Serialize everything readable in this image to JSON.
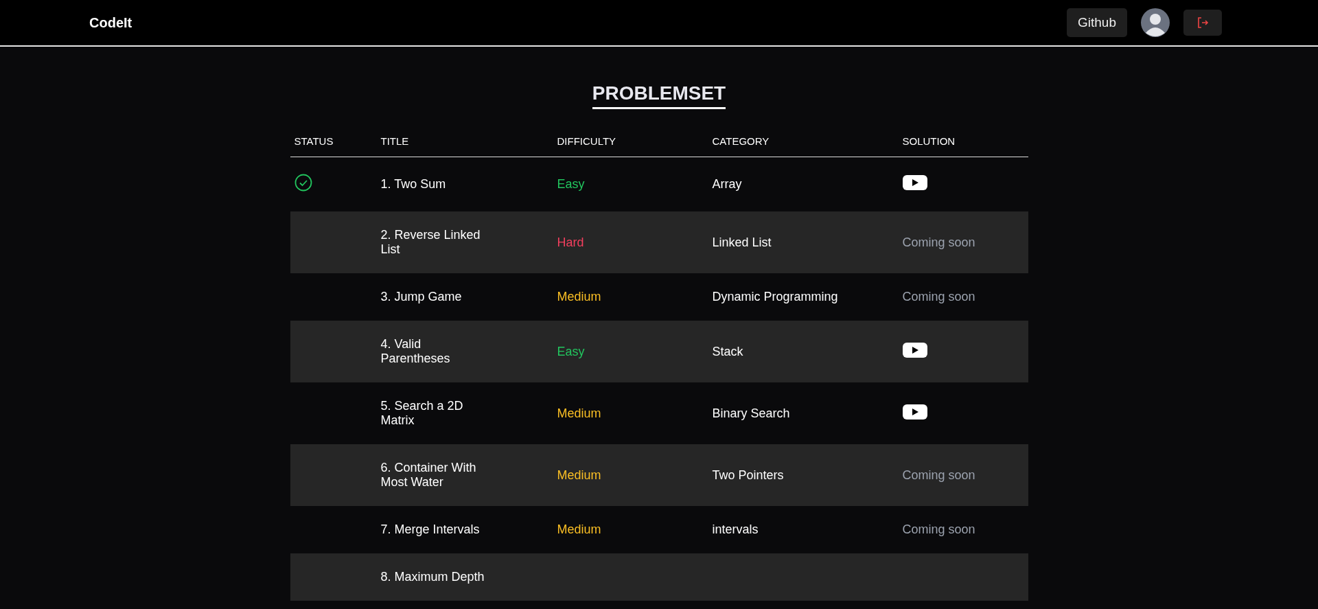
{
  "navbar": {
    "brand": "CodeIt",
    "github_button": "Github"
  },
  "title": "PROBLEMSET",
  "table": {
    "columns": [
      "STATUS",
      "TITLE",
      "DIFFICULTY",
      "CATEGORY",
      "SOLUTION"
    ],
    "rows": [
      {
        "solved": true,
        "title": "1. Two Sum",
        "difficulty": {
          "kind": "easy",
          "text": "Easy"
        },
        "category": "Array",
        "solution": {
          "kind": "video"
        }
      },
      {
        "solved": false,
        "title": "2. Reverse Linked List",
        "difficulty": {
          "kind": "hard",
          "text": "Hard"
        },
        "category": "Linked List",
        "solution": {
          "kind": "text",
          "text": "Coming soon"
        }
      },
      {
        "solved": false,
        "title": "3. Jump Game",
        "difficulty": {
          "kind": "medium",
          "text": "Medium"
        },
        "category": "Dynamic Programming",
        "solution": {
          "kind": "text",
          "text": "Coming soon"
        }
      },
      {
        "solved": false,
        "title": "4. Valid Parentheses",
        "difficulty": {
          "kind": "easy",
          "text": "Easy"
        },
        "category": "Stack",
        "solution": {
          "kind": "video"
        }
      },
      {
        "solved": false,
        "title": "5. Search a 2D Matrix",
        "difficulty": {
          "kind": "medium",
          "text": "Medium"
        },
        "category": "Binary Search",
        "solution": {
          "kind": "video"
        }
      },
      {
        "solved": false,
        "title": "6. Container With Most Water",
        "difficulty": {
          "kind": "medium",
          "text": "Medium"
        },
        "category": "Two Pointers",
        "solution": {
          "kind": "text",
          "text": "Coming soon"
        }
      },
      {
        "solved": false,
        "title": "7. Merge Intervals",
        "difficulty": {
          "kind": "medium",
          "text": "Medium"
        },
        "category": "intervals",
        "solution": {
          "kind": "text",
          "text": "Coming soon"
        }
      },
      {
        "solved": false,
        "title": "8. Maximum Depth"
      }
    ]
  }
}
